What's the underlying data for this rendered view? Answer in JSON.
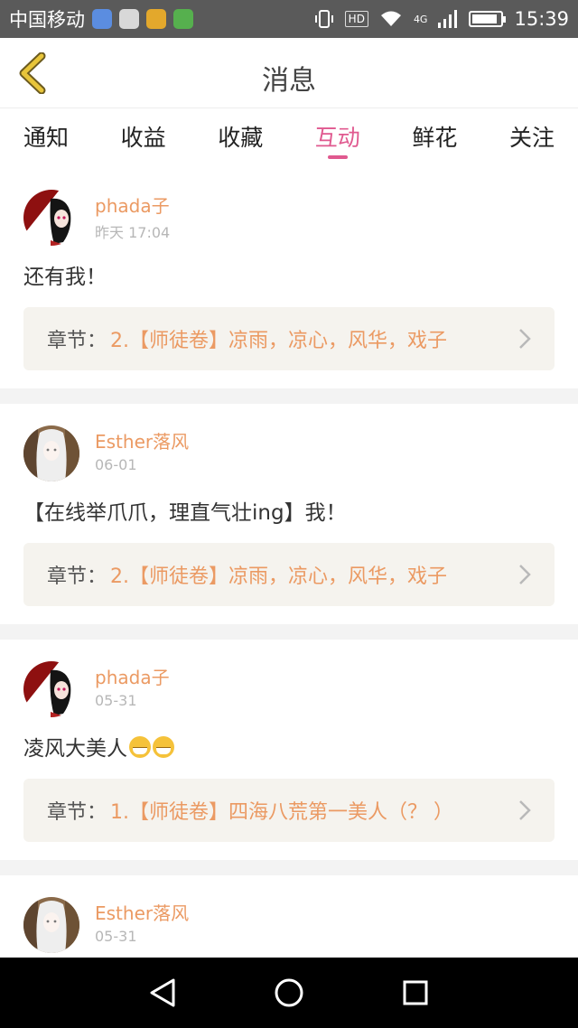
{
  "status_bar": {
    "carrier": "中国移动",
    "time": "15:39",
    "network": "4G",
    "hd_badge": "HD",
    "battery_level": 0.9
  },
  "header": {
    "title": "消息",
    "back_icon": "chevron-left-icon"
  },
  "tabs": [
    {
      "label": "通知",
      "active": false
    },
    {
      "label": "收益",
      "active": false
    },
    {
      "label": "收藏",
      "active": false
    },
    {
      "label": "互动",
      "active": true
    },
    {
      "label": "鲜花",
      "active": false
    },
    {
      "label": "关注",
      "active": false
    }
  ],
  "messages": [
    {
      "username": "phada子",
      "time": "昨天 17:04",
      "comment": "还有我！",
      "chapter_prefix": "章节：",
      "chapter_title": "2.【师徒卷】凉雨，凉心，风华，戏子"
    },
    {
      "username": "Esther落风",
      "time": "06-01",
      "comment": "【在线举爪爪，理直气壮ing】我！",
      "chapter_prefix": "章节：",
      "chapter_title": "2.【师徒卷】凉雨，凉心，风华，戏子"
    },
    {
      "username": "phada子",
      "time": "05-31",
      "comment": "凌风大美人",
      "chapter_prefix": "章节：",
      "chapter_title": "1.【师徒卷】四海八荒第一美人（？ ）"
    },
    {
      "username": "Esther落风",
      "time": "05-31"
    }
  ],
  "colors": {
    "accent": "#e0598f",
    "username": "#eb9a63",
    "status_bar": "#5a5a5a",
    "back_icon": "#e8c53a"
  }
}
